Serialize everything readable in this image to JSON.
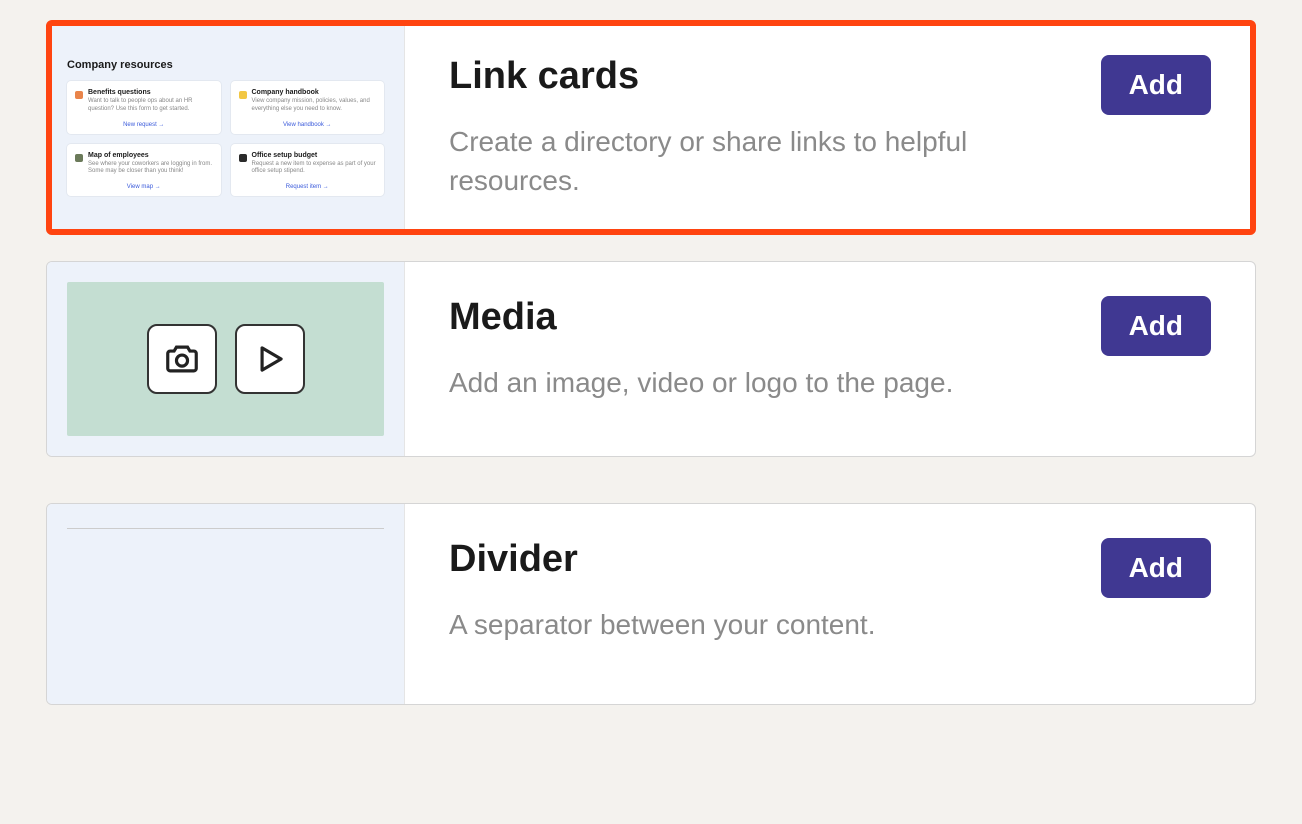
{
  "options": [
    {
      "title": "Link cards",
      "description": "Create a directory or share links to helpful resources.",
      "add_label": "Add",
      "preview": {
        "heading": "Company resources",
        "cards": [
          {
            "title": "Benefits questions",
            "desc": "Want to talk to people ops about an HR question? Use this form to get started.",
            "link": "New request →",
            "icon_color": "#e9844a"
          },
          {
            "title": "Company handbook",
            "desc": "View company mission, policies, values, and everything else you need to know.",
            "link": "View handbook →",
            "icon_color": "#f2c744"
          },
          {
            "title": "Map of employees",
            "desc": "See where your coworkers are logging in from. Some may be closer than you think!",
            "link": "View map →",
            "icon_color": "#6b7a5a"
          },
          {
            "title": "Office setup budget",
            "desc": "Request a new item to expense as part of your office setup stipend.",
            "link": "Request item →",
            "icon_color": "#2b2b2b"
          }
        ]
      }
    },
    {
      "title": "Media",
      "description": "Add an image, video or logo to the page.",
      "add_label": "Add"
    },
    {
      "title": "Divider",
      "description": "A separator between your content.",
      "add_label": "Add"
    }
  ]
}
